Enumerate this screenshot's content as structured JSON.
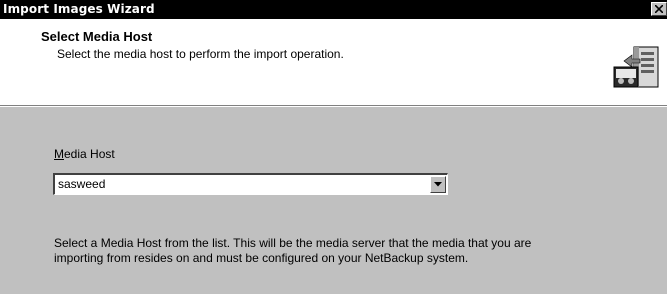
{
  "window": {
    "title": "Import Images Wizard",
    "close_symbol": "×"
  },
  "header": {
    "title": "Select Media Host",
    "subtitle": "Select the media host to perform the import operation.",
    "icon": "wizard-media-icon"
  },
  "form": {
    "media_host_label_mnemonic": "M",
    "media_host_label_rest": "edia Host",
    "media_host_value": "sasweed",
    "dropdown_icon": "chevron-down-icon"
  },
  "help": {
    "line1": "Select a Media Host from the list.  This will be the media server that the media that you are",
    "line2": "importing from resides on and must be configured on your NetBackup system."
  },
  "colors": {
    "titlebar_bg": "#000000",
    "dialog_bg": "#c0c0c0",
    "header_bg": "#ffffff"
  }
}
